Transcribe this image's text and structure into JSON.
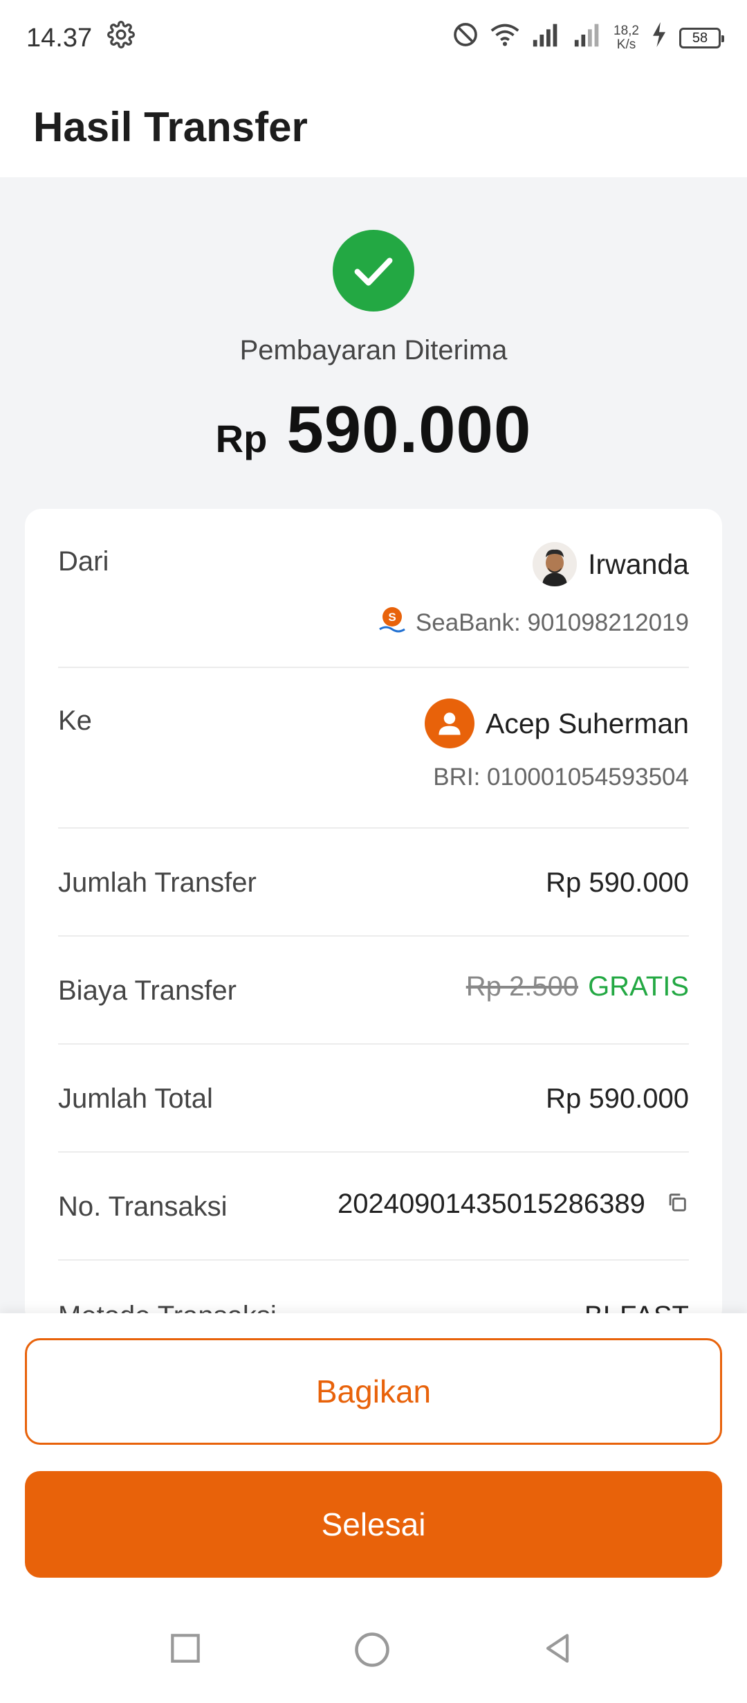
{
  "status_bar": {
    "time": "14.37",
    "net_speed_value": "18,2",
    "net_speed_unit": "K/s",
    "battery": "58"
  },
  "header": {
    "title": "Hasil Transfer"
  },
  "hero": {
    "status": "Pembayaran Diterima",
    "currency": "Rp",
    "amount": "590.000",
    "status_color": "#23a843"
  },
  "details": {
    "from": {
      "label": "Dari",
      "name": "Irwanda",
      "account": "SeaBank: 901098212019"
    },
    "to": {
      "label": "Ke",
      "name": "Acep Suherman",
      "account": "BRI: 010001054593504"
    },
    "rows": [
      {
        "label": "Jumlah Transfer",
        "value": "Rp 590.000"
      },
      {
        "label": "Biaya Transfer",
        "original": "Rp 2.500",
        "value": "GRATIS"
      },
      {
        "label": "Jumlah Total",
        "value": "Rp 590.000"
      },
      {
        "label": "No. Transaksi",
        "value": "20240901435015286389"
      },
      {
        "label": "Metode Transaksi",
        "value": "BI-FAST"
      }
    ]
  },
  "actions": {
    "share": "Bagikan",
    "done": "Selesai",
    "accent_color": "#e8620a"
  }
}
